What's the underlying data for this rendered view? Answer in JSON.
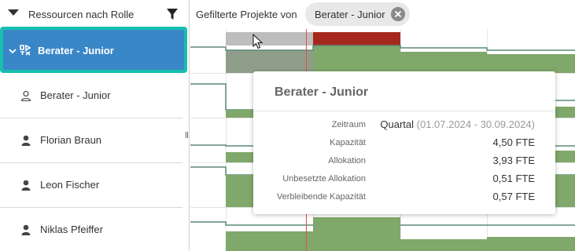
{
  "sidebar": {
    "header_title": "Ressourcen nach Rolle",
    "rows": [
      {
        "label": "Berater - Junior",
        "icon": "role-group-icon",
        "selected": true
      },
      {
        "label": "Berater - Junior",
        "icon": "person-outline-icon"
      },
      {
        "label": "Florian Braun",
        "icon": "person-icon"
      },
      {
        "label": "Leon Fischer",
        "icon": "person-icon"
      },
      {
        "label": "Niklas Pfeiffer",
        "icon": "person-icon"
      }
    ]
  },
  "header": {
    "filter_label": "Gefilterte Projekte von",
    "chip_label": "Berater - Junior"
  },
  "tooltip": {
    "title": "Berater - Junior",
    "zeitraum_label": "Zeitraum",
    "zeitraum_value": "Quartal",
    "zeitraum_range": "(01.07.2024 - 30.09.2024)",
    "kapazitaet_label": "Kapazität",
    "kapazitaet_value": "4,50 FTE",
    "allokation_label": "Allokation",
    "allokation_value": "3,93 FTE",
    "unbesetzt_label": "Unbesetzte Allokation",
    "unbesetzt_value": "0,51 FTE",
    "verbleibend_label": "Verbleibende Kapazität",
    "verbleibend_value": "0,57 FTE"
  },
  "colors": {
    "selected_row": "#3a87c8",
    "focus_ring": "#16bfae",
    "allocation_green": "#7fa86a",
    "overallocation_red": "#a5281c",
    "today_line": "#e05040",
    "capacity_line": "#5b8a7a"
  }
}
